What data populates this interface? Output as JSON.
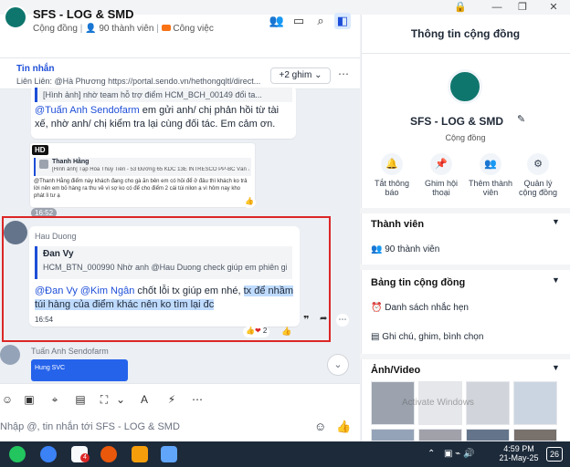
{
  "window": {
    "lock_icon": "lock-icon",
    "minimize": "—",
    "restore": "❐",
    "close": "✕"
  },
  "header": {
    "title": "SFS - LOG & SMD",
    "community": "Cộng đồng",
    "members": "90 thành viên",
    "work": "Công việc"
  },
  "pinbar": {
    "label": "Tin nhắn",
    "text": "Liên Liên: @Hà Phương https://portal.sendo.vn/hethongqltl/direct...",
    "pin_button": "+2 ghim"
  },
  "messages": {
    "m1_quote": "[Hình ảnh] nhờ team hỗ trợ điểm HCM_BCH_00149 đổi ta...",
    "m1_mention": "@Tuấn Anh Sendofarm",
    "m1_text": " em gửi anh/ chị phản hồi từ tài xế, nhờ anh/ chị kiểm tra lại cùng đối tác. Em cảm ơn.",
    "m2_badge": "HD",
    "m2_name": "Thanh Hằng",
    "m2_quote": "[Hình ảnh] Tạp Hóa Thùy Tiên - 53 Đường 65 KDC 13E INTRESCO PP-BC Văn 7 - 21/05/2025...",
    "m2_text": "@Thanh Hằng điểm này khách đang cho gà ăn bên em có hỏi để ở đâu thì khách ko trả lời nên em bỏ hàng ra thu về vì sợ ko có để cho điểm 2 cái túi nilon ạ vì hôm nay kho phát lì tư ạ",
    "m2_time": "16:52",
    "m3_sender": "Hau Duong",
    "m3_quote_name": "Đan Vy",
    "m3_quote_text": "HCM_BTN_000990 Nhờ anh @Hau Duong check giúp em phiên gi...",
    "m3_mention": "@Đan Vy @Kim Ngân",
    "m3_text_plain": " chốt lỗi tx giúp em nhé, ",
    "m3_text_hl": "tx để nhầm túi hàng của điểm khác nên ko tìm lại đc",
    "m3_time": "16:54",
    "m3_reaction_count": "2",
    "m4_sender": "Tuấn Anh Sendofarm",
    "m4_preview": "Hung SVC"
  },
  "composer": {
    "placeholder": "Nhập @, tin nhắn tới SFS - LOG & SMD"
  },
  "right_panel": {
    "title": "Thông tin cộng đồng",
    "name": "SFS - LOG & SMD",
    "type": "Cộng đồng",
    "actions": [
      {
        "label": "Tắt thông báo",
        "icon": "bell-icon"
      },
      {
        "label": "Ghim hội thoại",
        "icon": "pin-icon"
      },
      {
        "label": "Thêm thành viên",
        "icon": "add-member-icon"
      },
      {
        "label": "Quản lý cộng đồng",
        "icon": "gear-icon"
      }
    ],
    "members_title": "Thành viên",
    "members_count": "90 thành viên",
    "board_title": "Bảng tin cộng đồng",
    "reminders": "Danh sách nhắc hẹn",
    "notes": "Ghi chú, ghim, bình chọn",
    "media_title": "Ảnh/Video",
    "watermark": "Activate Windows"
  },
  "taskbar": {
    "time": "4:59 PM",
    "date": "21-May-25",
    "notif": "26",
    "badge": "4"
  }
}
